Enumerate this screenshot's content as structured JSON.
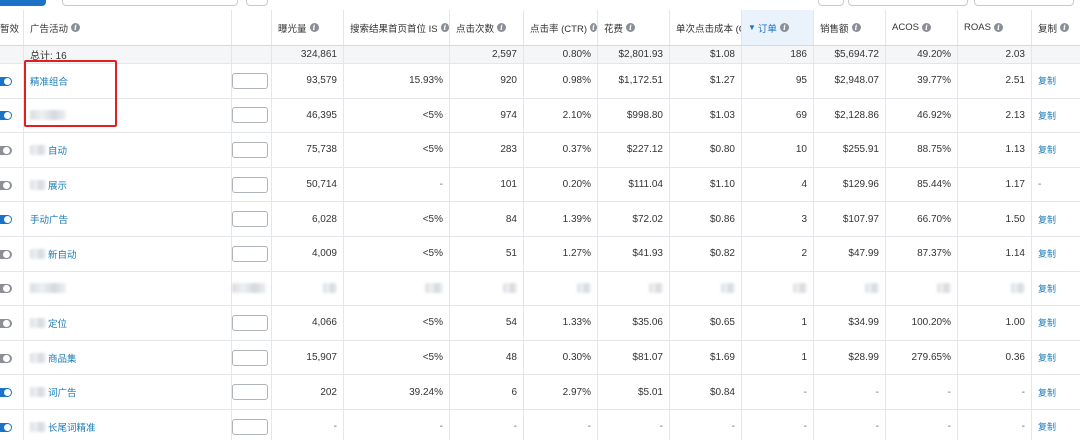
{
  "colors": {
    "accent": "#1a73c7",
    "link": "#1a7bb8",
    "highlight": "#e02020",
    "toggle_off": "#8c9096"
  },
  "header": {
    "status": "暂效",
    "campaign": "广告活动",
    "impressions": "曝光量",
    "top_of_search_is": "搜索结果首页首位 IS",
    "clicks": "点击次数",
    "ctr": "点击率 (CTR)",
    "spend": "花费",
    "cpc": "单次点击成本 (CPC",
    "orders": "订单",
    "sales": "销售额",
    "acos": "ACOS",
    "roas": "ROAS",
    "copy": "复制"
  },
  "total": {
    "label": "总计: 16",
    "impressions": "324,861",
    "clicks": "2,597",
    "ctr": "0.80%",
    "spend": "$2,801.93",
    "cpc": "$1.08",
    "orders": "186",
    "sales": "$5,694.72",
    "acos": "49.20%",
    "roas": "2.03"
  },
  "rows": [
    {
      "toggle": "on",
      "name": "精准组合",
      "blur_prefix": false,
      "blur_only": false,
      "impressions": "93,579",
      "tos": "15.93%",
      "clicks": "920",
      "ctr": "0.98%",
      "spend": "$1,172.51",
      "cpc": "$1.27",
      "orders": "95",
      "sales": "$2,948.07",
      "acos": "39.77%",
      "roas": "2.51",
      "copy": "复制"
    },
    {
      "toggle": "on",
      "name": "",
      "blur_prefix": false,
      "blur_only": true,
      "impressions": "46,395",
      "tos": "<5%",
      "clicks": "974",
      "ctr": "2.10%",
      "spend": "$998.80",
      "cpc": "$1.03",
      "orders": "69",
      "sales": "$2,128.86",
      "acos": "46.92%",
      "roas": "2.13",
      "copy": "复制"
    },
    {
      "toggle": "off",
      "name": "自动",
      "blur_prefix": true,
      "blur_only": false,
      "impressions": "75,738",
      "tos": "<5%",
      "clicks": "283",
      "ctr": "0.37%",
      "spend": "$227.12",
      "cpc": "$0.80",
      "orders": "10",
      "sales": "$255.91",
      "acos": "88.75%",
      "roas": "1.13",
      "copy": "复制"
    },
    {
      "toggle": "off",
      "name": "展示",
      "blur_prefix": true,
      "blur_only": false,
      "impressions": "50,714",
      "tos": "-",
      "clicks": "101",
      "ctr": "0.20%",
      "spend": "$111.04",
      "cpc": "$1.10",
      "orders": "4",
      "sales": "$129.96",
      "acos": "85.44%",
      "roas": "1.17",
      "copy": "-"
    },
    {
      "toggle": "on",
      "name": "手动广告",
      "blur_prefix": false,
      "blur_only": false,
      "impressions": "6,028",
      "tos": "<5%",
      "clicks": "84",
      "ctr": "1.39%",
      "spend": "$72.02",
      "cpc": "$0.86",
      "orders": "3",
      "sales": "$107.97",
      "acos": "66.70%",
      "roas": "1.50",
      "copy": "复制"
    },
    {
      "toggle": "off",
      "name": "新自动",
      "blur_prefix": true,
      "blur_only": false,
      "impressions": "4,009",
      "tos": "<5%",
      "clicks": "51",
      "ctr": "1.27%",
      "spend": "$41.93",
      "cpc": "$0.82",
      "orders": "2",
      "sales": "$47.99",
      "acos": "87.37%",
      "roas": "1.14",
      "copy": "复制"
    },
    {
      "toggle": "off",
      "name": "",
      "blur_prefix": false,
      "blur_only": true,
      "blurred_row": true,
      "impressions": "",
      "tos": "",
      "clicks": "",
      "ctr": "",
      "spend": "",
      "cpc": "",
      "orders": "",
      "sales": "",
      "acos": "",
      "roas": "",
      "copy": "复制"
    },
    {
      "toggle": "off",
      "name": "定位",
      "blur_prefix": true,
      "blur_only": false,
      "impressions": "4,066",
      "tos": "<5%",
      "clicks": "54",
      "ctr": "1.33%",
      "spend": "$35.06",
      "cpc": "$0.65",
      "orders": "1",
      "sales": "$34.99",
      "acos": "100.20%",
      "roas": "1.00",
      "copy": "复制"
    },
    {
      "toggle": "off",
      "name": "商品集",
      "blur_prefix": true,
      "blur_only": false,
      "impressions": "15,907",
      "tos": "<5%",
      "clicks": "48",
      "ctr": "0.30%",
      "spend": "$81.07",
      "cpc": "$1.69",
      "orders": "1",
      "sales": "$28.99",
      "acos": "279.65%",
      "roas": "0.36",
      "copy": "复制"
    },
    {
      "toggle": "on",
      "name": "词广告",
      "blur_prefix": true,
      "blur_only": false,
      "impressions": "202",
      "tos": "39.24%",
      "clicks": "6",
      "ctr": "2.97%",
      "spend": "$5.01",
      "cpc": "$0.84",
      "orders": "-",
      "sales": "-",
      "acos": "-",
      "roas": "-",
      "copy": "复制"
    },
    {
      "toggle": "on",
      "name": "长尾词精准",
      "blur_prefix": true,
      "blur_only": false,
      "impressions": "-",
      "tos": "-",
      "clicks": "-",
      "ctr": "-",
      "spend": "-",
      "cpc": "-",
      "orders": "-",
      "sales": "-",
      "acos": "-",
      "roas": "-",
      "copy": "复制"
    }
  ]
}
